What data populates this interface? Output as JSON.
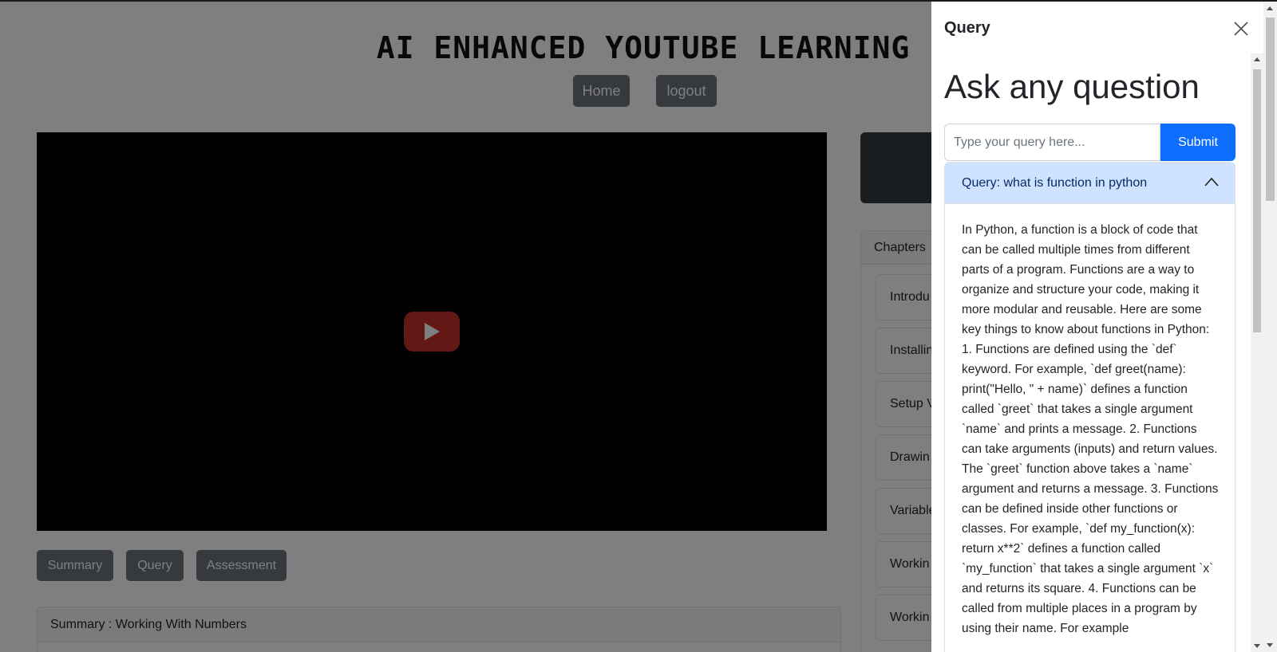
{
  "site": {
    "title": "AI ENHANCED YOUTUBE LEARNING",
    "nav": {
      "home_label": "Home",
      "logout_label": "logout"
    }
  },
  "video": {
    "play_icon": "youtube-play-icon"
  },
  "actions": {
    "summary_label": "Summary",
    "query_label": "Query",
    "assessment_label": "Assessment"
  },
  "summary": {
    "header": "Summary : Working With Numbers"
  },
  "chapters": {
    "header": "Chapters",
    "items": [
      {
        "label": "Introdu"
      },
      {
        "label": "Installin"
      },
      {
        "label": "Setup V"
      },
      {
        "label": "Drawin"
      },
      {
        "label": "Variable"
      },
      {
        "label": "Workin"
      },
      {
        "label": "Workin"
      }
    ]
  },
  "offcanvas": {
    "title": "Query",
    "close_icon": "close-icon",
    "heading": "Ask any question",
    "input_placeholder": "Type your query here...",
    "input_value": "",
    "submit_label": "Submit",
    "accordion": {
      "question": "Query: what is function in python",
      "toggle_icon": "chevron-up-icon",
      "answer": "In Python, a function is a block of code that can be called multiple times from different parts of a program. Functions are a way to organize and structure your code, making it more modular and reusable. Here are some key things to know about functions in Python: 1. Functions are defined using the `def` keyword. For example, `def greet(name): print(\"Hello, \" + name)` defines a function called `greet` that takes a single argument `name` and prints a message. 2. Functions can take arguments (inputs) and return values. The `greet` function above takes a `name` argument and returns a message. 3. Functions can be defined inside other functions or classes. For example, `def my_function(x): return x**2` defines a function called `my_function` that takes a single argument `x` and returns its square. 4. Functions can be called from multiple places in a program by using their name. For example"
    }
  },
  "colors": {
    "primary": "#0d6efd",
    "secondary": "#6c757d",
    "dark": "#343a40",
    "accordion_active": "#cfe2ff",
    "youtube_red": "#c4302b"
  }
}
